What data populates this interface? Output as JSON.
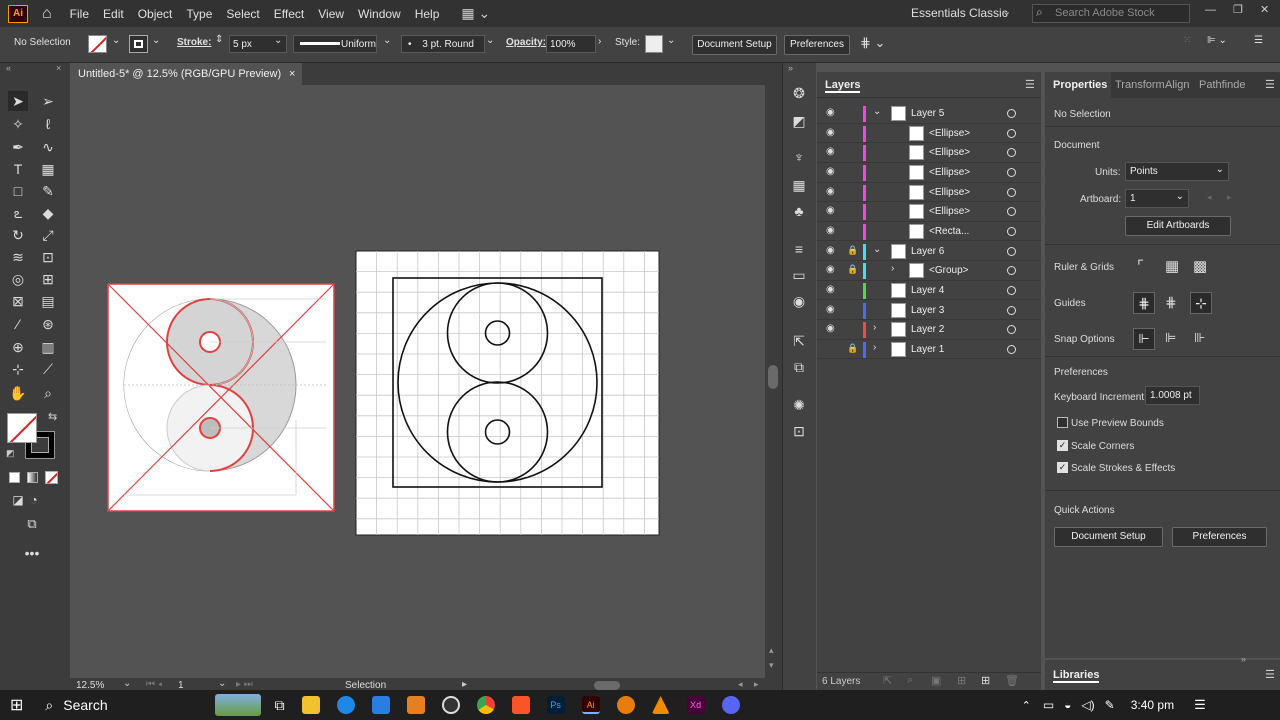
{
  "menu": [
    "File",
    "Edit",
    "Object",
    "Type",
    "Select",
    "Effect",
    "View",
    "Window",
    "Help"
  ],
  "app_logo": "Ai",
  "workspace": "Essentials Classic",
  "search_placeholder": "Search Adobe Stock",
  "control": {
    "selection": "No Selection",
    "stroke_label": "Stroke:",
    "stroke_value": "5 px",
    "profile": "Uniform",
    "brush": "3 pt. Round",
    "opacity_label": "Opacity:",
    "opacity_value": "100%",
    "style_label": "Style:",
    "doc_setup": "Document Setup",
    "preferences": "Preferences"
  },
  "doc_tab": "Untitled-5* @ 12.5% (RGB/GPU Preview)",
  "status": {
    "zoom": "12.5%",
    "artboard": "1",
    "tool": "Selection"
  },
  "layers": {
    "title": "Layers",
    "count": "6 Layers",
    "rows": [
      {
        "name": "Layer 5",
        "color": "#e74fcf",
        "expand": "open",
        "visible": true,
        "locked": false,
        "indent": 0
      },
      {
        "name": "<Ellipse>",
        "color": "#e74fcf",
        "visible": true,
        "locked": false,
        "indent": 1
      },
      {
        "name": "<Ellipse>",
        "color": "#e74fcf",
        "visible": true,
        "locked": false,
        "indent": 1
      },
      {
        "name": "<Ellipse>",
        "color": "#e74fcf",
        "visible": true,
        "locked": false,
        "indent": 1
      },
      {
        "name": "<Ellipse>",
        "color": "#e74fcf",
        "visible": true,
        "locked": false,
        "indent": 1
      },
      {
        "name": "<Ellipse>",
        "color": "#e74fcf",
        "visible": true,
        "locked": false,
        "indent": 1
      },
      {
        "name": "<Recta...",
        "color": "#e74fcf",
        "visible": true,
        "locked": false,
        "indent": 1
      },
      {
        "name": "Layer 6",
        "color": "#4fd8e7",
        "expand": "open",
        "visible": true,
        "locked": true,
        "indent": 0
      },
      {
        "name": "<Group>",
        "color": "#4fd8e7",
        "expand": "closed",
        "visible": true,
        "locked": true,
        "indent": 1
      },
      {
        "name": "Layer 4",
        "color": "#5bd14f",
        "visible": true,
        "locked": false,
        "indent": 0
      },
      {
        "name": "Layer 3",
        "color": "#4f6ae7",
        "visible": true,
        "locked": false,
        "indent": 0
      },
      {
        "name": "Layer 2",
        "color": "#e74f4f",
        "expand": "closed",
        "visible": true,
        "locked": false,
        "indent": 0
      },
      {
        "name": "Layer 1",
        "color": "#4f6ae7",
        "expand": "closed",
        "visible": false,
        "locked": true,
        "indent": 0
      }
    ]
  },
  "properties": {
    "tabs": [
      "Properties",
      "Transform",
      "Align",
      "Pathfinde"
    ],
    "selection": "No Selection",
    "document": "Document",
    "units_label": "Units:",
    "units_value": "Points",
    "artboard_label": "Artboard:",
    "artboard_value": "1",
    "edit_artboards": "Edit Artboards",
    "ruler_grids": "Ruler & Grids",
    "guides": "Guides",
    "snap": "Snap Options",
    "preferences": "Preferences",
    "kb_label": "Keyboard Increment:",
    "kb_value": "1.0008 pt",
    "use_preview": "Use Preview Bounds",
    "scale_corners": "Scale Corners",
    "scale_strokes": "Scale Strokes & Effects",
    "quick_actions": "Quick Actions",
    "doc_setup": "Document Setup",
    "prefs_btn": "Preferences"
  },
  "libraries": "Libraries",
  "taskbar": {
    "search": "Search",
    "time": "3:40 pm"
  },
  "colors": {
    "accent": "#ff9a00",
    "menubar": "#323232",
    "panel": "#424242",
    "canvas": "#535353"
  }
}
